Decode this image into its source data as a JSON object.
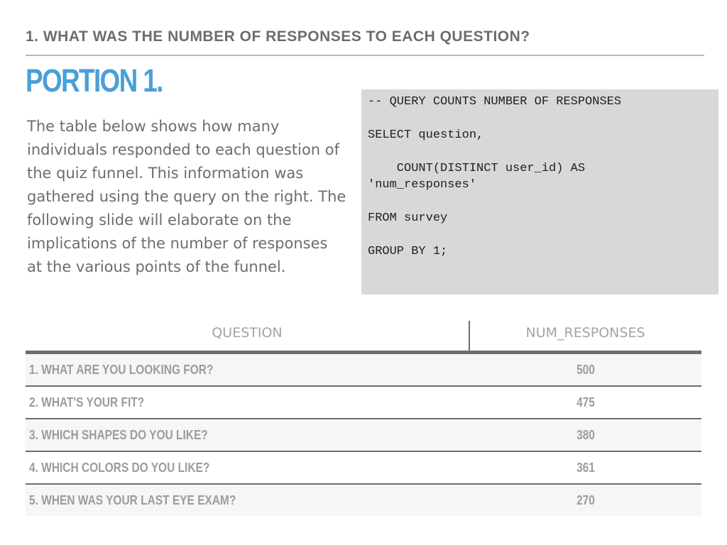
{
  "header": {
    "title": "1. WHAT WAS THE NUMBER OF RESPONSES TO EACH QUESTION?"
  },
  "section": {
    "title": "PORTION 1."
  },
  "description": "The table below shows how many individuals responded to each question of the quiz funnel. This information was gathered using the query on the right. The following slide will elaborate on the implications of the number of responses at the various points of the funnel.",
  "code": {
    "text": "-- QUERY COUNTS NUMBER OF RESPONSES\n\nSELECT question,\n\n    COUNT(DISTINCT user_id) AS\n'num_responses'\n\nFROM survey\n\nGROUP BY 1;"
  },
  "table": {
    "headers": {
      "question": "QUESTION",
      "num_responses": "NUM_RESPONSES"
    },
    "rows": [
      {
        "question": "1. WHAT ARE YOU LOOKING FOR?",
        "num_responses": "500"
      },
      {
        "question": "2. WHAT'S YOUR FIT?",
        "num_responses": "475"
      },
      {
        "question": "3. WHICH SHAPES DO YOU LIKE?",
        "num_responses": "380"
      },
      {
        "question": "4. WHICH COLORS DO YOU LIKE?",
        "num_responses": "361"
      },
      {
        "question": "5. WHEN WAS YOUR LAST EYE EXAM?",
        "num_responses": "270"
      }
    ]
  },
  "colors": {
    "accent": "#4a9fd8",
    "header_text": "#6a6d70",
    "body_text": "#6d6d6d",
    "code_background": "#d8d8d8",
    "table_text": "#9c9c9c"
  }
}
